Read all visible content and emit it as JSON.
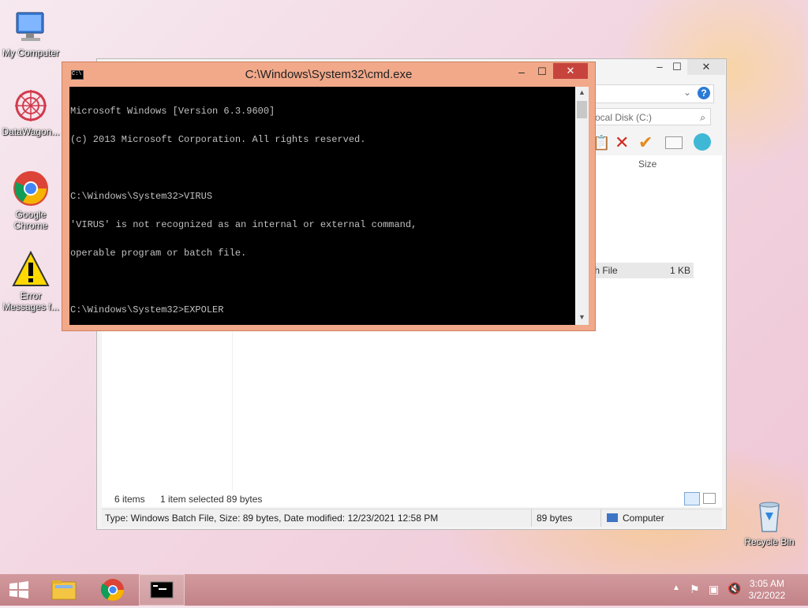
{
  "desktop": {
    "icons": [
      {
        "label": "My Computer"
      },
      {
        "label": "DataWagon..."
      },
      {
        "label": "Google Chrome"
      },
      {
        "label": "Error Messages f..."
      },
      {
        "label": "Recycle Bin"
      }
    ]
  },
  "explorer": {
    "search_placeholder": "ocal Disk (C:)",
    "column_size": "Size",
    "file_row": {
      "type_fragment": "tch File",
      "size": "1 KB"
    },
    "status": {
      "items": "6 items",
      "selected": "1 item selected  89 bytes"
    },
    "details": {
      "text": "Type: Windows Batch File, Size: 89 bytes, Date modified: 12/23/2021 12:58 PM",
      "size": "89 bytes",
      "location": "Computer"
    }
  },
  "cmd": {
    "title": "C:\\Windows\\System32\\cmd.exe",
    "lines": [
      "Microsoft Windows [Version 6.3.9600]",
      "(c) 2013 Microsoft Corporation. All rights reserved.",
      "",
      "C:\\Windows\\System32>VIRUS",
      "'VIRUS' is not recognized as an internal or external command,",
      "operable program or batch file.",
      "",
      "C:\\Windows\\System32>EXPOLER"
    ]
  },
  "taskbar": {
    "time": "3:05 AM",
    "date": "3/2/2022"
  },
  "colors": {
    "cmd_frame": "#f1a98a",
    "close_red": "#c7443d",
    "taskbar": "#c98a8f"
  }
}
